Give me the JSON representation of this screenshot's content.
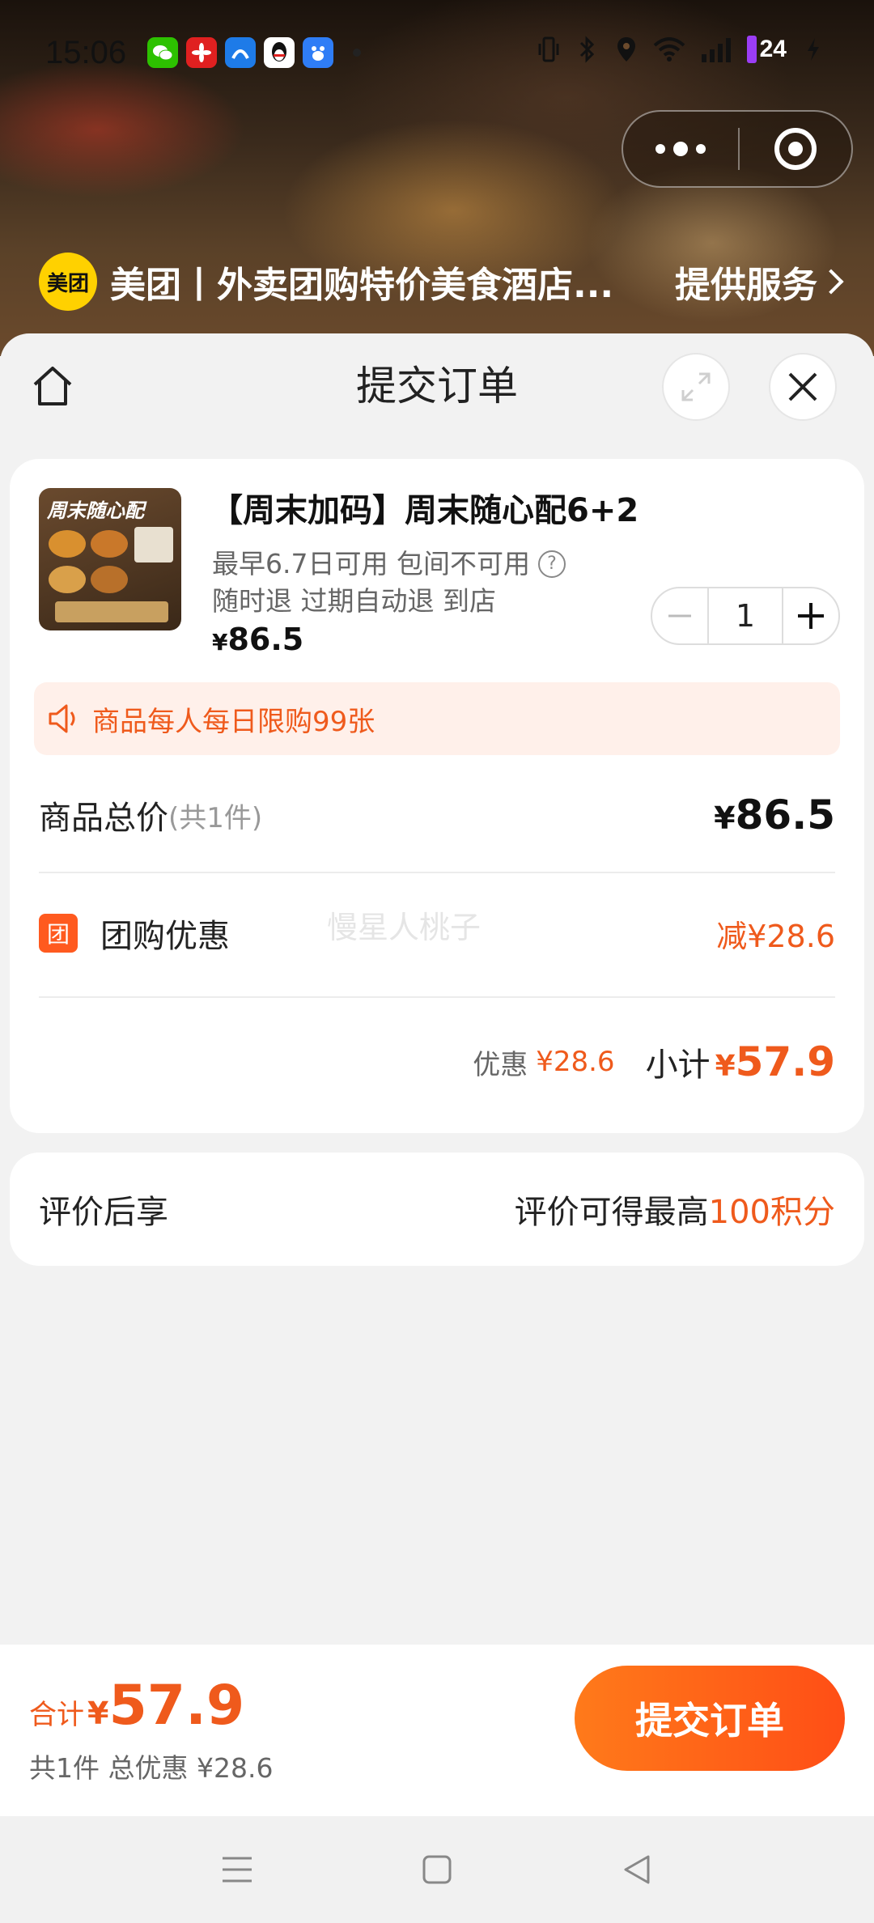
{
  "status_bar": {
    "time": "15:06",
    "battery": "24",
    "app_icons": [
      "wechat-icon",
      "huawei-icon",
      "ai-icon",
      "qq-icon",
      "baidu-icon"
    ]
  },
  "header": {
    "app_name": "美团丨外卖团购特价美食酒店...",
    "service_link": "提供服务",
    "logo_text": "美团"
  },
  "sheet": {
    "title": "提交订单"
  },
  "product": {
    "name": "【周末加码】周末随心配6+2",
    "thumb_text": "周末随心配",
    "meta_line1": "最早6.7日可用 包间不可用",
    "meta_line2": "随时退 过期自动退 到店",
    "price_symbol": "¥",
    "price": "86.5",
    "quantity": "1"
  },
  "limit_notice": "商品每人每日限购99张",
  "summary": {
    "total_label": "商品总价",
    "total_count": "(共1件)",
    "total_symbol": "¥",
    "total_value": "86.5",
    "discount_badge": "团",
    "discount_label": "团购优惠",
    "discount_value": "减¥28.6",
    "watermark": "慢星人桃子",
    "saved_label": "优惠",
    "saved_value": "¥28.6",
    "subtotal_label": "小计",
    "subtotal_symbol": "¥",
    "subtotal_value": "57.9"
  },
  "review": {
    "label": "评价后享",
    "reward_prefix": "评价可得最高",
    "reward_highlight": "100积分"
  },
  "bottom": {
    "total_label": "合计",
    "total_symbol": "¥",
    "total_value": "57.9",
    "total_sub": "共1件 总优惠 ¥28.6",
    "submit_label": "提交订单"
  },
  "colors": {
    "accent": "#ef5a1c",
    "button_start": "#ff7a1a",
    "button_end": "#ff4e16",
    "brand_yellow": "#ffd100"
  }
}
